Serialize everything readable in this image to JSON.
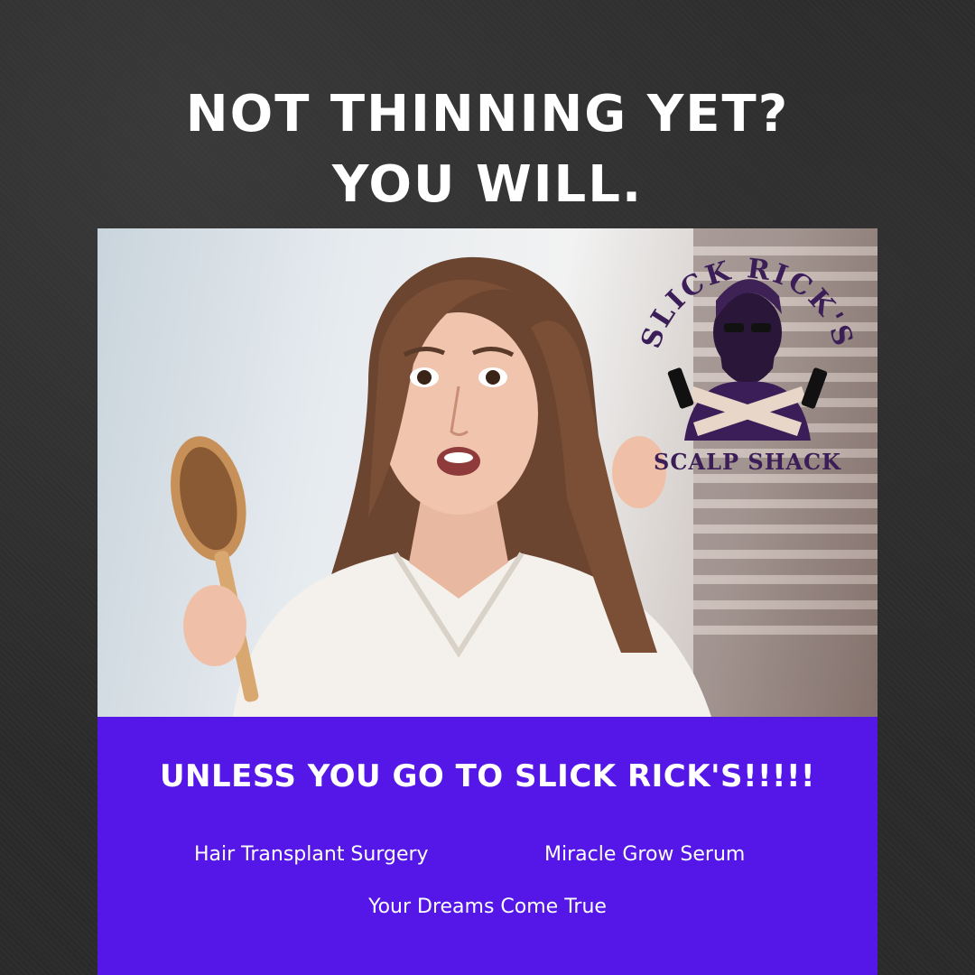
{
  "headline": {
    "line1": "NOT THINNING YET?",
    "line2": "YOU WILL."
  },
  "logo": {
    "top_text": "SLICK RICK'S",
    "bottom_text": "SCALP SHACK"
  },
  "panel": {
    "tagline": "UNLESS YOU GO TO SLICK RICK'S!!!!!",
    "services": [
      "Hair Transplant Surgery",
      "Miracle Grow Serum",
      "Your Dreams Come True"
    ]
  },
  "colors": {
    "background": "#2b2b2b",
    "panel": "#5417e8",
    "logo_purple": "#3b1e57",
    "text": "#ffffff"
  }
}
